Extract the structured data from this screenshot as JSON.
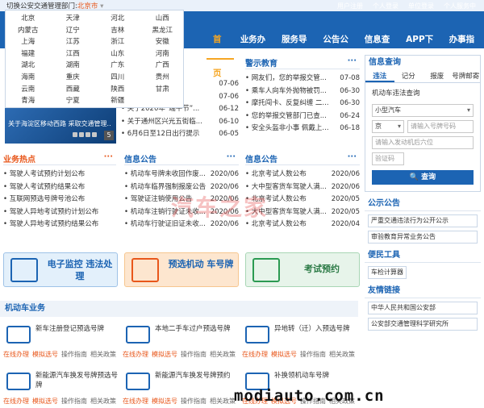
{
  "top": {
    "links": [
      "用户注册",
      "个人登录",
      "单位登录",
      "个人服务中"
    ]
  },
  "city_switch": {
    "label": "切换公安交通管理部门:",
    "current": "北京市"
  },
  "cities": [
    "北京",
    "天津",
    "河北",
    "山西",
    "内蒙古",
    "辽宁",
    "吉林",
    "黑龙江",
    "上海",
    "江苏",
    "浙江",
    "安徽",
    "福建",
    "江西",
    "山东",
    "河南",
    "湖北",
    "湖南",
    "广东",
    "广西",
    "海南",
    "重庆",
    "四川",
    "贵州",
    "云南",
    "西藏",
    "陕西",
    "甘肃",
    "青海",
    "宁夏",
    "新疆",
    ""
  ],
  "nav": [
    "首页",
    "业务办理",
    "服务导航",
    "公告公布",
    "信息查询",
    "APP下载",
    "办事指南"
  ],
  "banner": {
    "caption": "关于海淀区移动西路 采取交通管理...",
    "page": "5"
  },
  "col1": {
    "rows": [
      {
        "t": "提示",
        "d": "07-06"
      },
      {
        "t": "期好...",
        "d": "07-06"
      },
      {
        "t": "关于2020年“端午节”...",
        "d": "06-12"
      },
      {
        "t": "关于通州区兴光五街临...",
        "d": "06-10"
      },
      {
        "t": "6月6日至12日出行提示",
        "d": "06-05"
      }
    ]
  },
  "safety": {
    "title": "警示教育",
    "rows": [
      {
        "t": "网友们，您的举报交管...",
        "d": "07-08"
      },
      {
        "t": "乘车人向车外抛物被罚...",
        "d": "06-30"
      },
      {
        "t": "摩托闯卡、反复纠缠 二...",
        "d": "06-30"
      },
      {
        "t": "您的举报交管部门已查...",
        "d": "06-24"
      },
      {
        "t": "安全头盔非小事 佩戴上...",
        "d": "06-18"
      }
    ]
  },
  "hot": {
    "title": "业务热点",
    "rows": [
      {
        "t": "驾驶人考试预约计划公布"
      },
      {
        "t": "驾驶人考试预约结果公布"
      },
      {
        "t": "互联网预选号牌号池公布"
      },
      {
        "t": "驾驶人异地考试预约计划公布"
      },
      {
        "t": "驾驶人异地考试预约结果公布"
      }
    ]
  },
  "notice": {
    "title": "信息公告",
    "rows": [
      {
        "t": "机动车号牌未收回作废...",
        "d": "2020/06"
      },
      {
        "t": "机动车临界强制报废公告",
        "d": "2020/06"
      },
      {
        "t": "驾驶证注销使用公告",
        "d": "2020/06"
      },
      {
        "t": "机动车注销行驶证未收...",
        "d": "2020/06"
      },
      {
        "t": "机动车行驶证旧证未收...",
        "d": "2020/06"
      }
    ]
  },
  "notice2": {
    "title": "信息公告",
    "rows": [
      {
        "t": "北京考试人数公布",
        "d": "2020/06"
      },
      {
        "t": "大中型客货车驾驶人满...",
        "d": "2020/06"
      },
      {
        "t": "北京考试人数公布",
        "d": "2020/05"
      },
      {
        "t": "大中型客货车驾驶人满...",
        "d": "2020/05"
      },
      {
        "t": "北京考试人数公布",
        "d": "2020/04"
      }
    ]
  },
  "tiles": [
    {
      "label": "电子监控 违法处理"
    },
    {
      "label": "预选机动 车号牌"
    },
    {
      "label": "考试预约"
    }
  ],
  "vehicle": {
    "title": "机动车业务",
    "items": [
      {
        "name": "新车注册登记预选号牌"
      },
      {
        "name": "本地二手车过户预选号牌"
      },
      {
        "name": "异地转（迁）入预选号牌"
      },
      {
        "name": "新能源汽车换发号牌预选号牌"
      },
      {
        "name": "新能源汽车换发号牌预约"
      },
      {
        "name": "补换领机动车号牌"
      }
    ],
    "actions": [
      "在线办理",
      "模拟选号",
      "操作指南",
      "相关政策"
    ]
  },
  "query": {
    "title": "信息查询",
    "tabs": [
      "违法",
      "记分",
      "报废",
      "号牌邮寄"
    ],
    "subtitle": "机动车违法查询",
    "vehicle_type": "小型汽车",
    "province": "京",
    "plate_placeholder": "请输入号牌号码",
    "engine_placeholder": "请输入发动机后六位",
    "captcha_placeholder": "验证码",
    "button": "查询"
  },
  "announce": {
    "title": "公示公告",
    "items": [
      "严重交通违法行为公开公示",
      "审验教育异常业务公告"
    ]
  },
  "tools": {
    "title": "便民工具",
    "items": [
      "车检计算器"
    ]
  },
  "friends": {
    "title": "友情链接",
    "items": [
      "中华人民共和国公安部",
      "公安部交通管理科学研究所"
    ]
  },
  "watermark": "汽车之家",
  "footer": "modiauto.com.cn",
  "colors": {
    "primary": "#1c64b3",
    "accent": "#f6a623",
    "hot": "#e8571b"
  }
}
